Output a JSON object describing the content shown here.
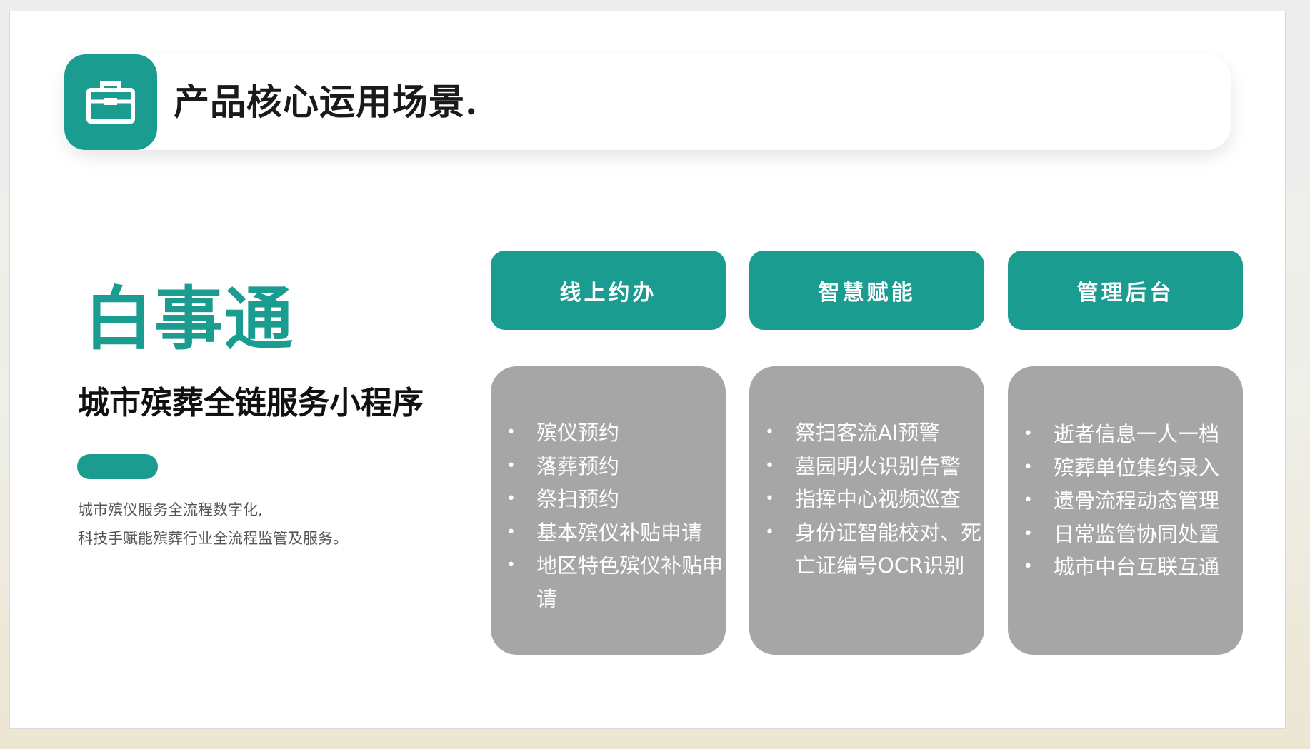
{
  "colors": {
    "accent": "#1a9c91",
    "card_bg": "#a6a6a6",
    "title_text": "#1a1a1a",
    "desc_text": "#555555"
  },
  "header": {
    "icon": "briefcase-icon",
    "title": "产品核心运用场景."
  },
  "intro": {
    "brand": "白事通",
    "tagline": "城市殡葬全链服务小程序",
    "description_lines": [
      "城市殡仪服务全流程数字化,",
      "科技手赋能殡葬行业全流程监管及服务。"
    ]
  },
  "columns": [
    {
      "title": "线上约办",
      "items": [
        "殡仪预约",
        "落葬预约",
        "祭扫预约",
        "基本殡仪补贴申请",
        "地区特色殡仪补贴申请"
      ]
    },
    {
      "title": "智慧赋能",
      "items": [
        "祭扫客流AI预警",
        "墓园明火识别告警",
        "指挥中心视频巡查",
        "身份证智能校对、死亡证编号OCR识别"
      ]
    },
    {
      "title": "管理后台",
      "items": [
        "逝者信息一人一档",
        "殡葬单位集约录入",
        "遗骨流程动态管理",
        "日常监管协同处置",
        "城市中台互联互通"
      ]
    }
  ]
}
